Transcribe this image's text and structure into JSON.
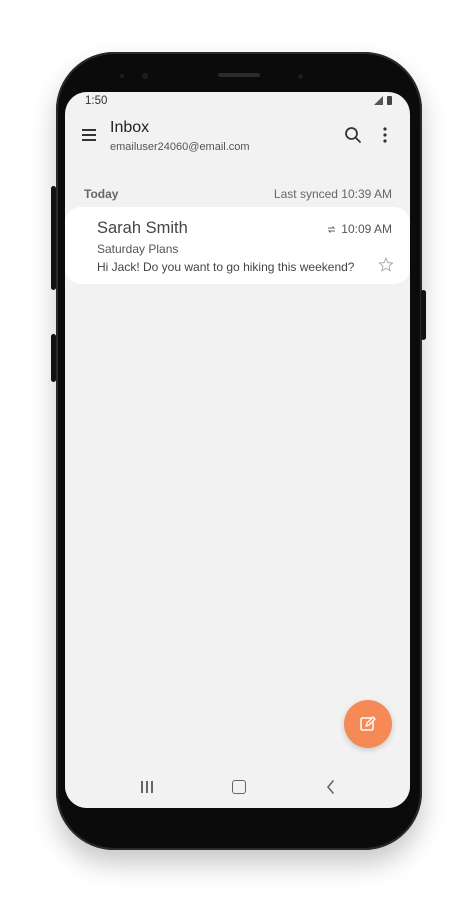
{
  "status_bar": {
    "time": "1:50"
  },
  "app_bar": {
    "title": "Inbox",
    "account_email": "emailuser24060@email.com"
  },
  "section": {
    "label": "Today",
    "last_synced": "Last synced  10:39 AM"
  },
  "messages": [
    {
      "sender": "Sarah Smith",
      "time": "10:09 AM",
      "subject": "Saturday Plans",
      "preview": "Hi Jack! Do you want to go hiking this weekend?",
      "starred": false
    }
  ],
  "icons": {
    "menu": "hamburger-icon",
    "search": "search-icon",
    "more": "more-vertical-icon",
    "sync": "sync-icon",
    "star": "star-outline-icon",
    "compose": "compose-icon",
    "nav_recent": "recent-apps-icon",
    "nav_home": "home-icon",
    "nav_back": "back-icon"
  },
  "colors": {
    "accent": "#f58a57",
    "screen_background": "#f2f2f2",
    "card_background": "#ffffff",
    "phone_body": "#0b0b0b"
  }
}
